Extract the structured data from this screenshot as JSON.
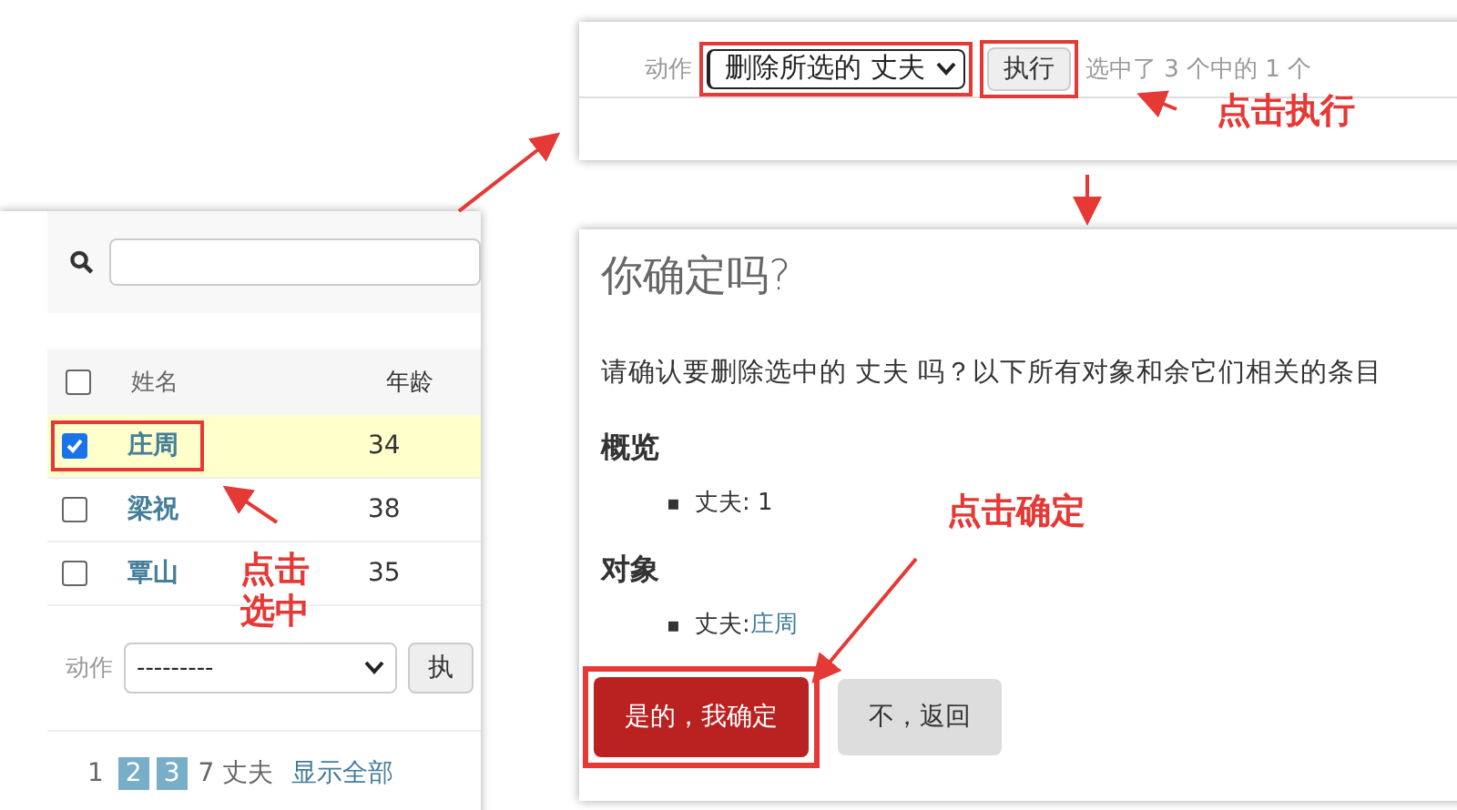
{
  "action_bar": {
    "label": "动作",
    "select_value": "删除所选的 丈夫",
    "button": "执行",
    "selection_count": "选中了 3 个中的 1 个"
  },
  "change_list": {
    "select_all_checked": false,
    "columns": [
      "姓名",
      "年龄"
    ],
    "rows": [
      {
        "name": "庄周",
        "age": "34",
        "selected": true
      },
      {
        "name": "梁祝",
        "age": "38",
        "selected": false
      },
      {
        "name": "覃山",
        "age": "35",
        "selected": false
      }
    ],
    "action_label": "动作",
    "action_select": "---------",
    "action_button": "执",
    "pages": [
      {
        "label": "1",
        "selected": true
      },
      {
        "label": "2",
        "selected": false
      },
      {
        "label": "3",
        "selected": false
      }
    ],
    "count": "7 丈夫",
    "show_all": "显示全部"
  },
  "confirmation": {
    "title": "你确定吗?",
    "message": "请确认要删除选中的 丈夫 吗？以下所有对象和余它们相关的条目",
    "summary_heading": "概览",
    "summary_items": [
      {
        "marker": "▪",
        "label": "丈夫: 1"
      }
    ],
    "objects_heading": "对象",
    "object_items": [
      {
        "marker": "▪",
        "label": "丈夫: ",
        "link": "庄周"
      }
    ],
    "confirm_button": "是的，我确定",
    "cancel_button": "不，返回"
  },
  "annotations": [
    {
      "text": "点击执行"
    },
    {
      "text": "点击选中"
    },
    {
      "text": "点击确定"
    }
  ]
}
